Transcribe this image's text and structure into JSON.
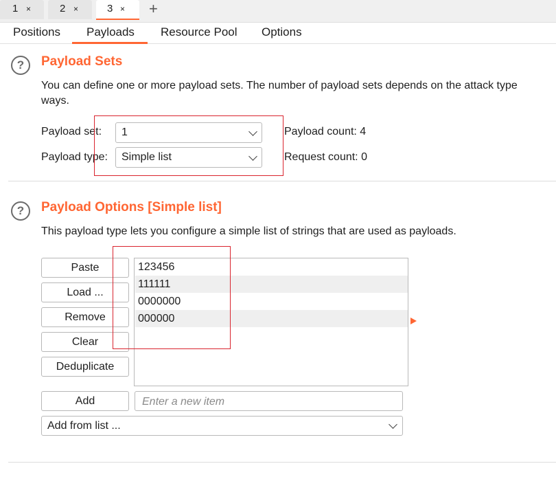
{
  "request_tabs": [
    {
      "number": "1",
      "close": "×"
    },
    {
      "number": "2",
      "close": "×"
    },
    {
      "number": "3",
      "close": "×"
    }
  ],
  "new_tab_symbol": "+",
  "subtabs": [
    {
      "label": "Positions"
    },
    {
      "label": "Payloads"
    },
    {
      "label": "Resource Pool"
    },
    {
      "label": "Options"
    }
  ],
  "active_subtab": "Payloads",
  "payload_sets": {
    "help_symbol": "?",
    "title": "Payload Sets",
    "description_line1": "You can define one or more payload sets. The number of payload sets depends on the attack type",
    "description_line2": "ways.",
    "set_label": "Payload set:",
    "set_value": "1",
    "type_label": "Payload type:",
    "type_value": "Simple list",
    "payload_count": "Payload count: 4",
    "request_count": "Request count: 0"
  },
  "payload_options": {
    "help_symbol": "?",
    "title": "Payload Options [Simple list]",
    "description": "This payload type lets you configure a simple list of strings that are used as payloads.",
    "buttons": {
      "paste": "Paste",
      "load": "Load ...",
      "remove": "Remove",
      "clear": "Clear",
      "deduplicate": "Deduplicate",
      "add": "Add"
    },
    "items": [
      "123456",
      "111111",
      "0000000",
      "000000"
    ],
    "new_item_placeholder": "Enter a new item",
    "add_from_list": "Add from list ..."
  },
  "colors": {
    "accent": "#ff6633",
    "annotation": "#d9232d"
  }
}
